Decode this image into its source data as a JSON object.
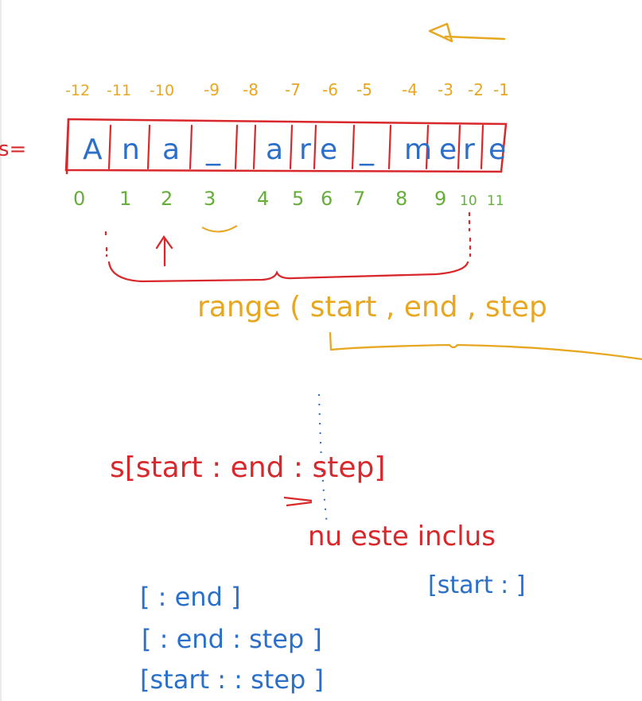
{
  "canvas": {
    "colors": {
      "orange": "#e8a721",
      "red": "#d9282b",
      "blue": "#2a6fc9",
      "green": "#66ad3a"
    }
  },
  "string_label": "s=",
  "negative_indices": [
    "-12",
    "-11",
    "-10",
    "-9",
    "-8",
    "-7",
    "-6",
    "-5",
    "-4",
    "-3",
    "-2",
    "-1"
  ],
  "characters": [
    "A",
    "n",
    "a",
    "_",
    "a",
    "r",
    "e",
    "_",
    "m",
    "e",
    "r",
    "e"
  ],
  "positive_indices": [
    "0",
    "1",
    "2",
    "3",
    "4",
    "5",
    "6",
    "7",
    "8",
    "9",
    "10",
    "11"
  ],
  "range_text": "range ( start , end , step",
  "slice_text": "s[start : end : step]",
  "not_included_text": "nu este inclus",
  "start_only_text": "[start : ]",
  "forms": [
    "[ : end ]",
    "[ : end : step ]",
    "[start : : step ]"
  ]
}
